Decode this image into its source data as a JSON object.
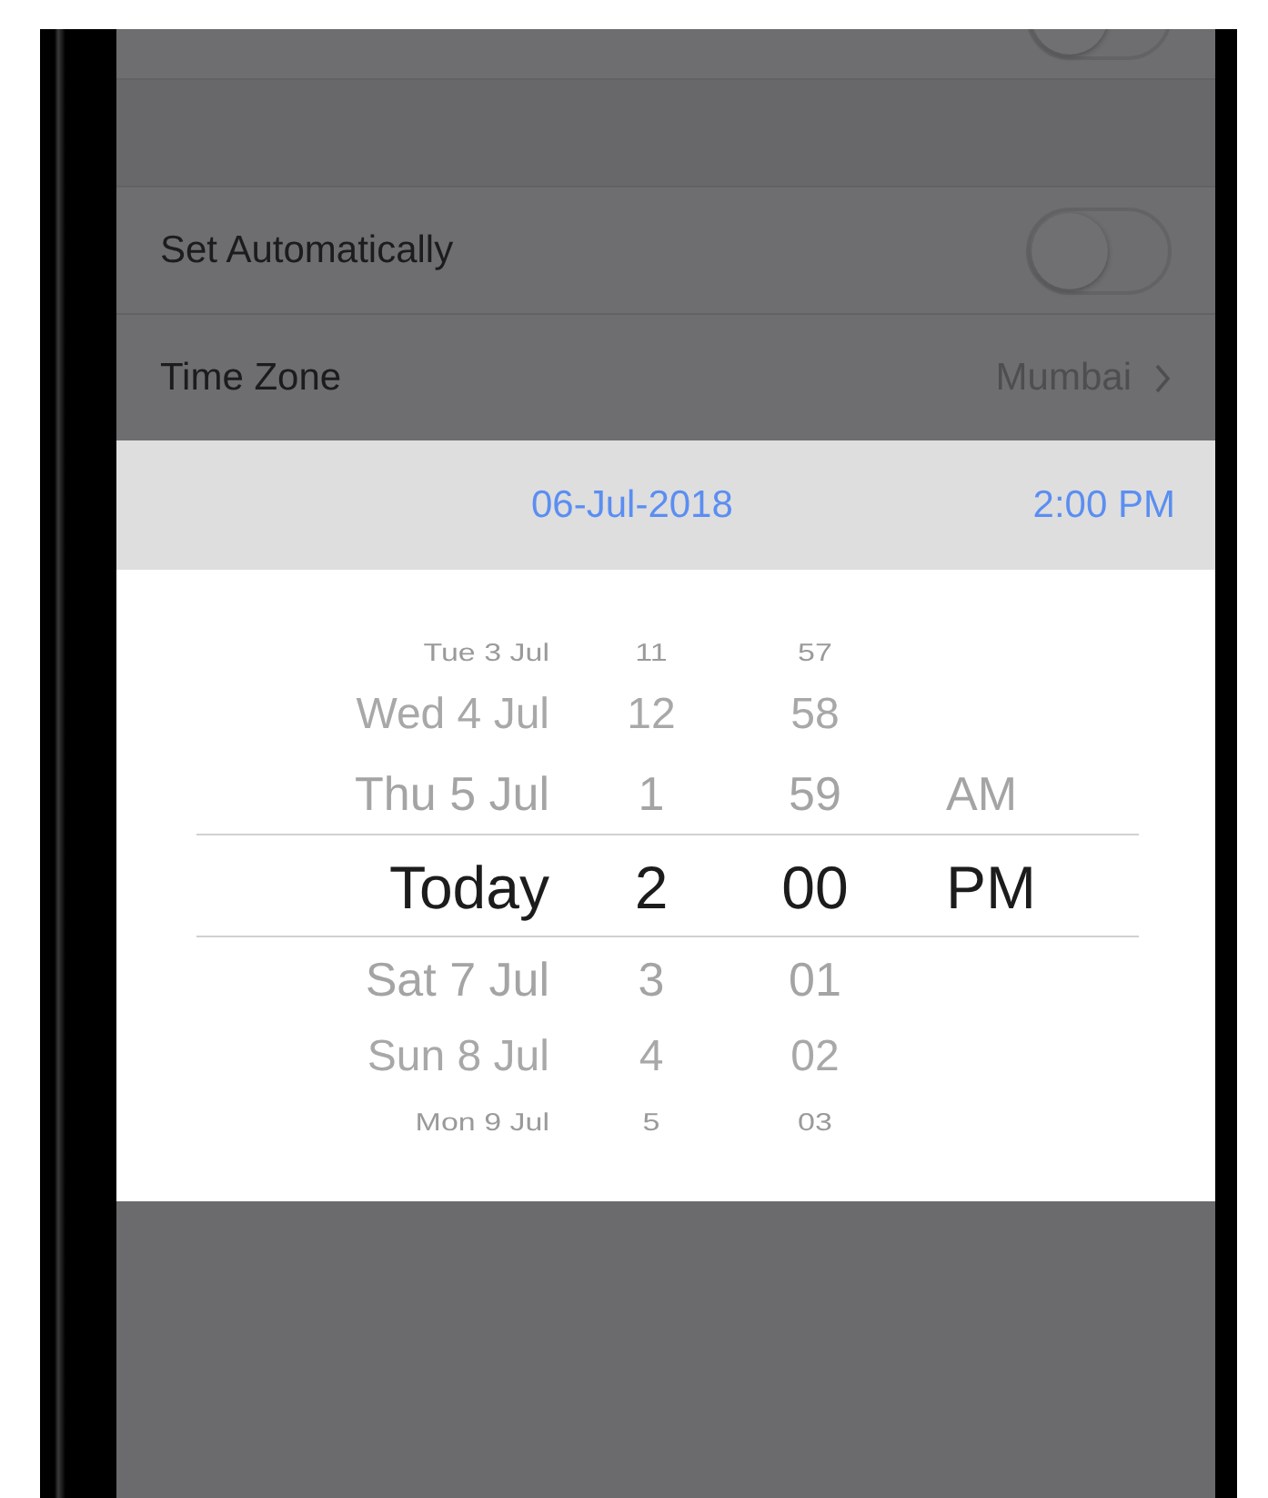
{
  "settings": [
    {
      "kind": "toggle",
      "on": false
    },
    {
      "kind": "spacer"
    },
    {
      "kind": "toggle",
      "label": "Set Automatically",
      "on": false
    },
    {
      "kind": "link",
      "label": "Time Zone",
      "value": "Mumbai"
    }
  ],
  "header": {
    "date": "06-Jul-2018",
    "time": "2:00 PM"
  },
  "picker": {
    "columns": [
      {
        "kind": "date",
        "items": [
          {
            "label": "Tue 3 Jul",
            "selected": false
          },
          {
            "label": "Wed 4 Jul",
            "selected": false
          },
          {
            "label": "Thu 5 Jul",
            "selected": false
          },
          {
            "label": "Today",
            "selected": true
          },
          {
            "label": "Sat 7 Jul",
            "selected": false
          },
          {
            "label": "Sun 8 Jul",
            "selected": false
          },
          {
            "label": "Mon 9 Jul",
            "selected": false
          }
        ]
      },
      {
        "kind": "hour",
        "items": [
          {
            "label": "11",
            "selected": false
          },
          {
            "label": "12",
            "selected": false
          },
          {
            "label": "1",
            "selected": false
          },
          {
            "label": "2",
            "selected": true
          },
          {
            "label": "3",
            "selected": false
          },
          {
            "label": "4",
            "selected": false
          },
          {
            "label": "5",
            "selected": false
          }
        ]
      },
      {
        "kind": "minute",
        "items": [
          {
            "label": "57",
            "selected": false
          },
          {
            "label": "58",
            "selected": false
          },
          {
            "label": "59",
            "selected": false
          },
          {
            "label": "00",
            "selected": true
          },
          {
            "label": "01",
            "selected": false
          },
          {
            "label": "02",
            "selected": false
          },
          {
            "label": "03",
            "selected": false
          }
        ]
      },
      {
        "kind": "ampm",
        "items": [
          {
            "label": "AM",
            "selected": false
          },
          {
            "label": "PM",
            "selected": true
          }
        ]
      }
    ]
  }
}
